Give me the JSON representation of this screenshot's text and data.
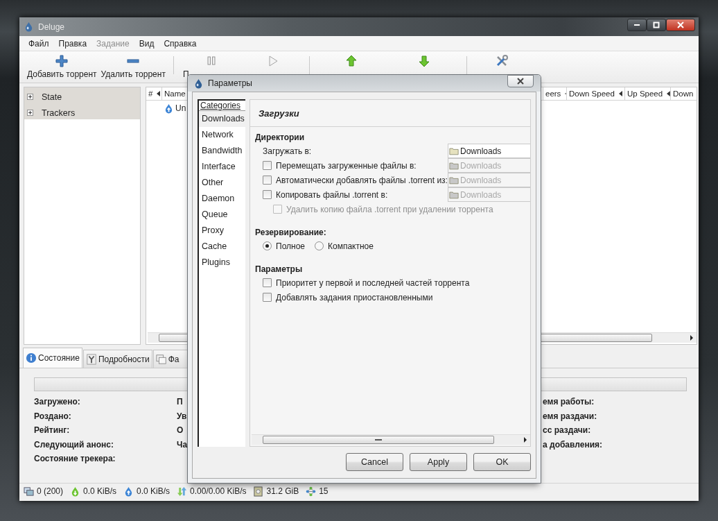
{
  "window": {
    "title": "Deluge"
  },
  "menu": [
    {
      "label": "Файл",
      "disabled": false
    },
    {
      "label": "Правка",
      "disabled": false
    },
    {
      "label": "Задание",
      "disabled": true
    },
    {
      "label": "Вид",
      "disabled": false
    },
    {
      "label": "Справка",
      "disabled": false
    }
  ],
  "toolbar": [
    {
      "kind": "add",
      "label": "Добавить торрент"
    },
    {
      "kind": "remove",
      "label": "Удалить торрент"
    },
    {
      "kind": "separator"
    },
    {
      "kind": "pause",
      "label": "П",
      "disabled": true
    },
    {
      "kind": "resume",
      "disabled": true
    },
    {
      "kind": "separator"
    },
    {
      "kind": "up",
      "disabled": false
    },
    {
      "kind": "down",
      "disabled": false
    },
    {
      "kind": "separator"
    },
    {
      "kind": "preferences",
      "disabled": false
    }
  ],
  "sidebar": {
    "items": [
      {
        "label": "State",
        "expanded": false
      },
      {
        "label": "Trackers",
        "expanded": false
      }
    ]
  },
  "torrent_list": {
    "columns": [
      "#",
      "Name",
      "eers",
      "Down Speed",
      "Up Speed",
      "Down"
    ],
    "rows": [
      {
        "name": "Un",
        "kind": "seeding"
      }
    ]
  },
  "detail_tabs": [
    {
      "label": "Состояние",
      "kind": "info",
      "selected": true
    },
    {
      "label": "Подробности",
      "kind": "details",
      "selected": false
    },
    {
      "label": "Фа",
      "kind": "files",
      "selected": false
    }
  ],
  "details": {
    "progress": {
      "level": 0
    },
    "columns": [
      [
        "Загружено:",
        "Роздано:",
        "Рейтинг:",
        "Следующий анонс:",
        "Состояние трекера:"
      ],
      [
        "П",
        "Ув",
        "О",
        "Ча"
      ],
      [
        "емя работы:",
        "емя раздачи:",
        "сс раздачи:",
        "а добавления:"
      ]
    ]
  },
  "status_bar": [
    {
      "kind": "connections",
      "text": "0 (200)"
    },
    {
      "kind": "download",
      "text": "0.0 KiB/s"
    },
    {
      "kind": "upload",
      "text": "0.0 KiB/s"
    },
    {
      "kind": "protocol",
      "text": "0.00/0.00 KiB/s"
    },
    {
      "kind": "disk",
      "text": "31.2 GiB"
    },
    {
      "kind": "nodes",
      "text": "15"
    }
  ],
  "dialog": {
    "title": "Параметры",
    "categories_header": "Categories",
    "categories": [
      {
        "label": "Downloads",
        "selected": true
      },
      {
        "label": "Network",
        "selected": false
      },
      {
        "label": "Bandwidth",
        "selected": false
      },
      {
        "label": "Interface",
        "selected": false
      },
      {
        "label": "Other",
        "selected": false
      },
      {
        "label": "Daemon",
        "selected": false
      },
      {
        "label": "Queue",
        "selected": false
      },
      {
        "label": "Proxy",
        "selected": false
      },
      {
        "label": "Cache",
        "selected": false
      },
      {
        "label": "Plugins",
        "selected": false
      }
    ],
    "page_title": "Загрузки",
    "sections": [
      {
        "title": "Директории",
        "rows": [
          {
            "kind": "folder",
            "label": "Загружать в:",
            "folder": "Downloads",
            "folder_disabled": false
          },
          {
            "kind": "check_folder",
            "label": "Перемещать загруженные файлы в:",
            "checked": false,
            "folder": "Downloads",
            "folder_disabled": true
          },
          {
            "kind": "check_folder",
            "label": "Автоматически добавлять файлы .torrent из:",
            "checked": false,
            "folder": "Downloads",
            "folder_disabled": true
          },
          {
            "kind": "check_folder",
            "label": "Копировать файлы .torrent в:",
            "checked": false,
            "folder": "Downloads",
            "folder_disabled": true,
            "children": [
              {
                "label": "Удалить копию файла .torrent при удалении торрента",
                "checked": false,
                "disabled": true
              }
            ]
          }
        ]
      },
      {
        "title": "Резервирование:",
        "rows": [
          {
            "kind": "radio",
            "options": [
              {
                "label": "Полное",
                "selected": true
              },
              {
                "label": "Компактное",
                "selected": false
              }
            ]
          }
        ]
      },
      {
        "title": "Параметры",
        "rows": [
          {
            "kind": "check",
            "label": "Приоритет у первой и последней частей торрента",
            "checked": false,
            "disabled": false
          },
          {
            "kind": "check",
            "label": "Добавлять задания приостановленными",
            "checked": false,
            "disabled": false
          }
        ]
      }
    ],
    "buttons": [
      "Cancel",
      "Apply",
      "OK"
    ]
  }
}
